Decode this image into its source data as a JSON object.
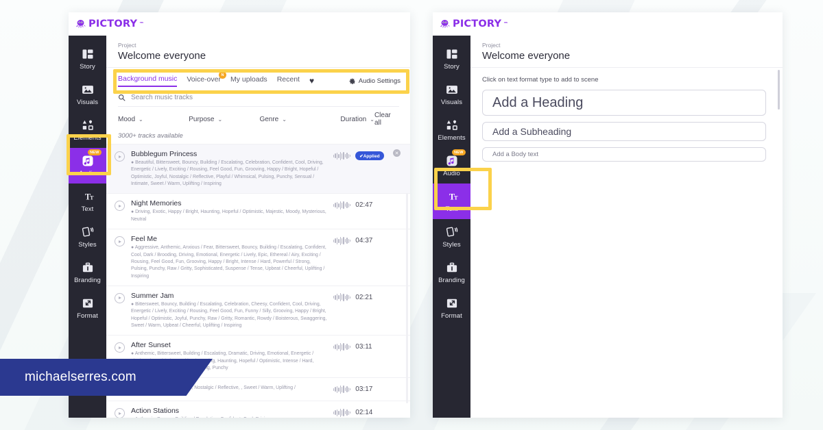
{
  "brand": {
    "name": "PICTORY",
    "tm": "™",
    "color": "#8B2FE8"
  },
  "watermark": {
    "text": "michaelserres.com",
    "color": "#2B3990"
  },
  "left_window": {
    "project": {
      "kicker": "Project",
      "title": "Welcome everyone"
    },
    "nav": [
      {
        "label": "Story",
        "icon": "layout-icon",
        "active": false,
        "badge": ""
      },
      {
        "label": "Visuals",
        "icon": "image-icon",
        "active": false,
        "badge": ""
      },
      {
        "label": "Elements",
        "icon": "shapes-icon",
        "active": false,
        "badge": ""
      },
      {
        "label": "Audio",
        "icon": "music-icon",
        "active": true,
        "badge": "NEW"
      },
      {
        "label": "Text",
        "icon": "text-icon",
        "active": false,
        "badge": ""
      },
      {
        "label": "Styles",
        "icon": "cards-icon",
        "active": false,
        "badge": ""
      },
      {
        "label": "Branding",
        "icon": "briefcase-icon",
        "active": false,
        "badge": ""
      },
      {
        "label": "Format",
        "icon": "resize-icon",
        "active": false,
        "badge": ""
      }
    ],
    "tabs": [
      {
        "label": "Background music",
        "active": true,
        "badge": ""
      },
      {
        "label": "Voice-over",
        "active": false,
        "badge": "N"
      },
      {
        "label": "My uploads",
        "active": false,
        "badge": ""
      },
      {
        "label": "Recent",
        "active": false,
        "badge": ""
      }
    ],
    "favorites_icon": "heart-icon",
    "audio_settings": {
      "label": "Audio Settings",
      "icon": "gear-icon"
    },
    "search": {
      "placeholder": "Search music tracks",
      "value": "",
      "icon": "search-icon"
    },
    "filters": [
      {
        "label": "Mood"
      },
      {
        "label": "Purpose"
      },
      {
        "label": "Genre"
      },
      {
        "label": "Duration"
      }
    ],
    "clear_all": "Clear all",
    "tracks_available": "3000+ tracks available",
    "applied_badge": "✔Applied",
    "tracks": [
      {
        "name": "Bubblegum Princess",
        "tags": "● Beautiful, Bittersweet, Bouncy, Building / Escalating, Celebration, Confident, Cool, Driving, Energetic / Lively, Exciting / Rousing, Feel Good, Fun, Grooving, Happy / Bright, Hopeful / Optimistic, Joyful, Nostalgic / Reflective, Playful / Whimsical, Pulsing, Punchy, Sensual / Intimate, Sweet / Warm, Uplifting / Inspiring",
        "duration": "",
        "applied": true
      },
      {
        "name": "Night Memories",
        "tags": "● Driving, Exotic, Happy / Bright, Haunting, Hopeful / Optimistic, Majestic, Moody, Mysterious, Neutral",
        "duration": "02:47",
        "applied": false
      },
      {
        "name": "Feel Me",
        "tags": "● Aggressive, Anthemic, Anxious / Fear, Bittersweet, Bouncy, Building / Escalating, Confident, Cool, Dark / Brooding, Driving, Emotional, Energetic / Lively, Epic, Ethereal / Airy, Exciting / Rousing, Feel Good, Fun, Grooving, Happy / Bright, Intense / Hard, Powerful / Strong, Pulsing, Punchy, Raw / Gritty, Sophisticated, Suspense / Tense, Upbeat / Cheerful, Uplifting / Inspiring",
        "duration": "04:37",
        "applied": false
      },
      {
        "name": "Summer Jam",
        "tags": "● Bittersweet, Bouncy, Building / Escalating, Celebration, Cheesy, Confident, Cool, Driving, Energetic / Lively, Exciting / Rousing, Feel Good, Fun, Funny / Silly, Grooving, Happy / Bright, Hopeful / Optimistic, Joyful, Punchy, Raw / Gritty, Romantic, Rowdy / Boisterous, Swaggering, Sweet / Warm, Upbeat / Cheerful, Uplifting / Inspiring",
        "duration": "02:21",
        "applied": false
      },
      {
        "name": "After Sunset",
        "tags": "● Anthemic, Bittersweet, Building / Escalating, Dramatic, Driving, Emotional, Energetic / Lively, Ethereal / Airy, Exciting / Rousing, Haunting, Hopeful / Optimistic, Intense / Hard, Moody, Nostalgic / Reflective, Pulsing, Punchy",
        "duration": "03:11",
        "applied": false
      },
      {
        "name": "",
        "tags": "ood, Gentle / Soft, Happy / al, Nostalgic / Reflective, , Sweet / Warm, Uplifting /",
        "duration": "03:17",
        "applied": false
      },
      {
        "name": "Action Stations",
        "tags": "● Anthemic, Bouncy, Building / Escalating, Confident, Cool, Driving",
        "duration": "02:14",
        "applied": false
      }
    ]
  },
  "right_window": {
    "project": {
      "kicker": "Project",
      "title": "Welcome everyone"
    },
    "nav": [
      {
        "label": "Story",
        "icon": "layout-icon",
        "active": false,
        "badge": ""
      },
      {
        "label": "Visuals",
        "icon": "image-icon",
        "active": false,
        "badge": ""
      },
      {
        "label": "Elements",
        "icon": "shapes-icon",
        "active": false,
        "badge": ""
      },
      {
        "label": "Audio",
        "icon": "music-icon",
        "active": false,
        "badge": "NEW"
      },
      {
        "label": "Text",
        "icon": "text-icon",
        "active": true,
        "badge": ""
      },
      {
        "label": "Styles",
        "icon": "cards-icon",
        "active": false,
        "badge": ""
      },
      {
        "label": "Branding",
        "icon": "briefcase-icon",
        "active": false,
        "badge": ""
      },
      {
        "label": "Format",
        "icon": "resize-icon",
        "active": false,
        "badge": ""
      }
    ],
    "hint": "Click on text format type to add to scene",
    "text_formats": [
      {
        "label": "Add a Heading"
      },
      {
        "label": "Add a Subheading"
      },
      {
        "label": "Add a Body text"
      }
    ]
  },
  "highlights": {
    "color": "#FBD24B"
  }
}
